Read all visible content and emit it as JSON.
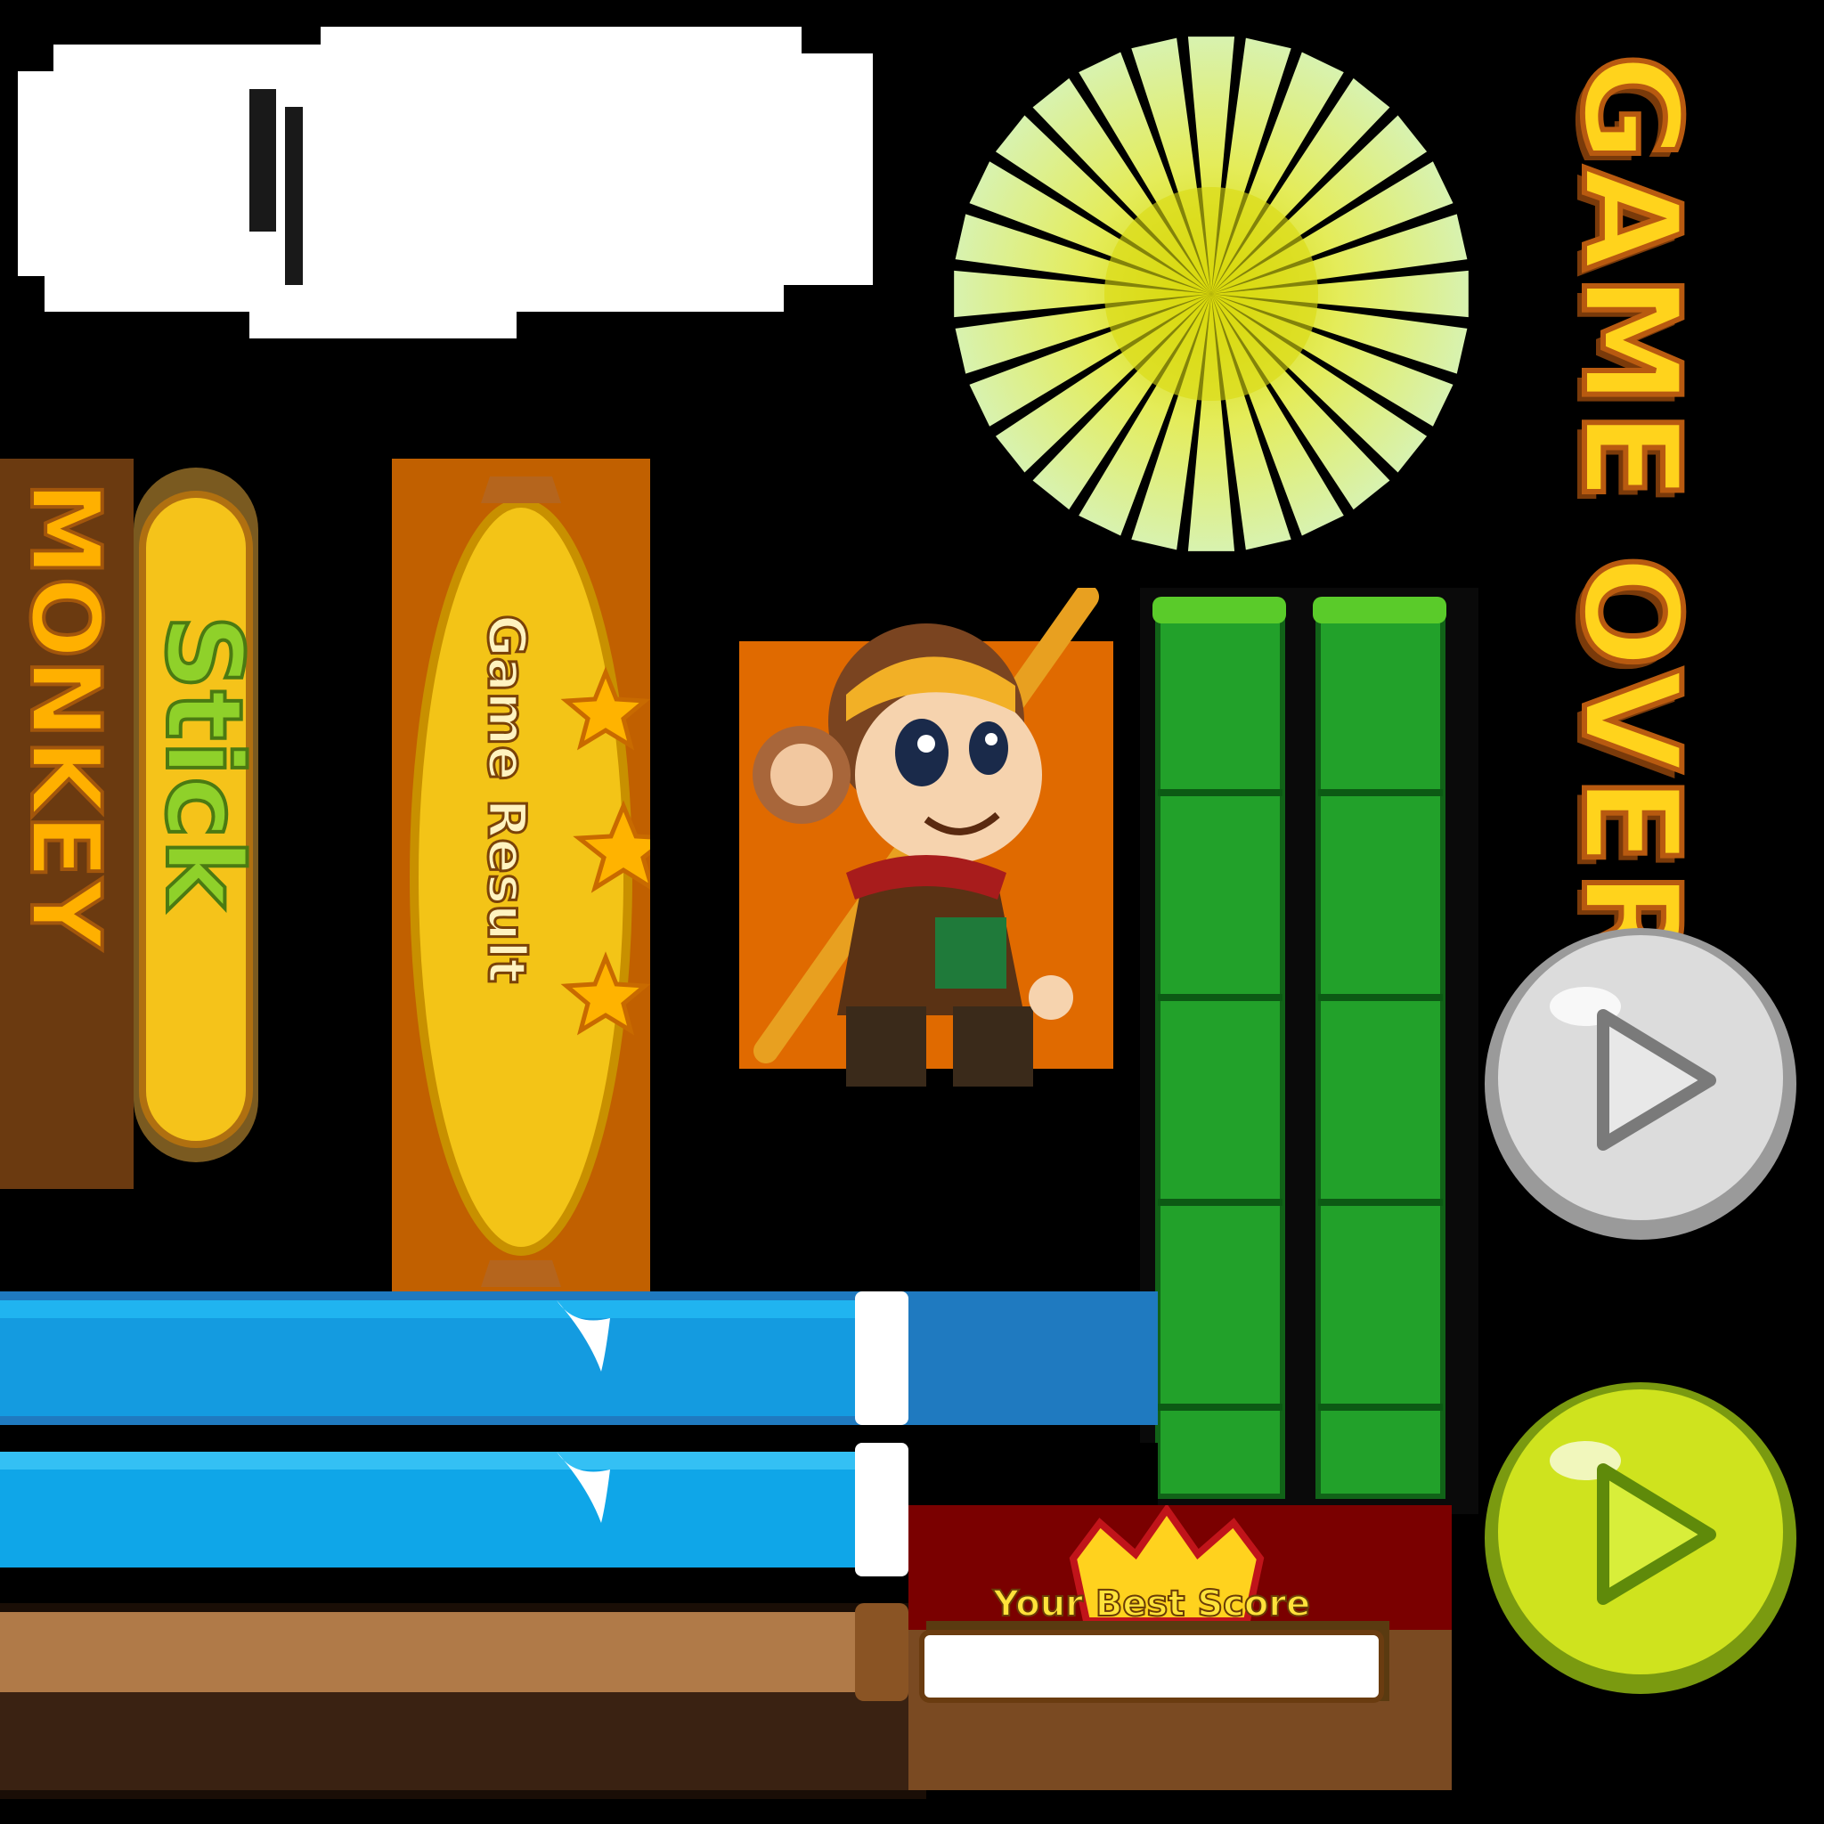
{
  "title": {
    "game_over": "GAME OVER"
  },
  "logo": {
    "line1": "Stick",
    "line2": "MONKEY"
  },
  "panel": {
    "game_result": "Game Result"
  },
  "score": {
    "label": "Your Best Score",
    "value": ""
  },
  "buttons": {
    "play_gray": {
      "icon": "play-icon",
      "color": "#d8d8d8"
    },
    "play_green": {
      "icon": "play-icon",
      "color": "#c8e21e"
    }
  },
  "colors": {
    "background": "#000000",
    "water": "#119be0",
    "bamboo": "#2aa12e",
    "wood": "#b07a48",
    "gold": "#ffc21a"
  }
}
